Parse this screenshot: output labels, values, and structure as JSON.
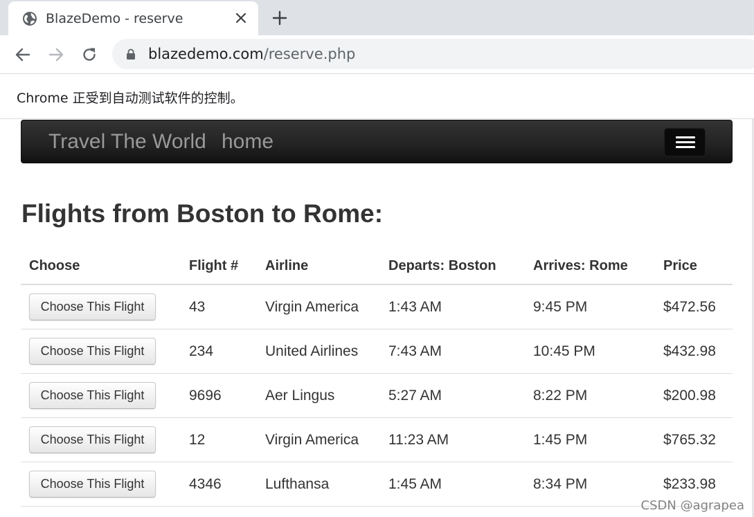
{
  "browser": {
    "tab_title": "BlazeDemo - reserve",
    "url_host": "blazedemo.com",
    "url_path": "/reserve.php",
    "automation_notice": "Chrome 正受到自动测试软件的控制。"
  },
  "navbar": {
    "brand": "Travel The World",
    "home_link": "home"
  },
  "page": {
    "heading": "Flights from Boston to Rome:"
  },
  "table": {
    "headers": [
      "Choose",
      "Flight #",
      "Airline",
      "Departs: Boston",
      "Arrives: Rome",
      "Price"
    ],
    "button_label": "Choose This Flight",
    "rows": [
      {
        "flight": "43",
        "airline": "Virgin America",
        "departs": "1:43 AM",
        "arrives": "9:45 PM",
        "price": "$472.56"
      },
      {
        "flight": "234",
        "airline": "United Airlines",
        "departs": "7:43 AM",
        "arrives": "10:45 PM",
        "price": "$432.98"
      },
      {
        "flight": "9696",
        "airline": "Aer Lingus",
        "departs": "5:27 AM",
        "arrives": "8:22 PM",
        "price": "$200.98"
      },
      {
        "flight": "12",
        "airline": "Virgin America",
        "departs": "11:23 AM",
        "arrives": "1:45 PM",
        "price": "$765.32"
      },
      {
        "flight": "4346",
        "airline": "Lufthansa",
        "departs": "1:45 AM",
        "arrives": "8:34 PM",
        "price": "$233.98"
      }
    ]
  },
  "watermark": "CSDN @agrapea",
  "colors": {
    "navbar_bg": "#222222",
    "navbar_text": "#999999",
    "text": "#333333",
    "chrome_tabstrip": "#dee1e6",
    "omnibox_bg": "#f1f3f4"
  },
  "icons": {
    "tab_favicon": "globe-icon",
    "tab_close": "close-icon",
    "new_tab": "plus-icon",
    "back": "back-arrow-icon",
    "forward": "forward-arrow-icon",
    "reload": "reload-icon",
    "secure": "lock-icon",
    "menu": "hamburger-menu-icon"
  }
}
